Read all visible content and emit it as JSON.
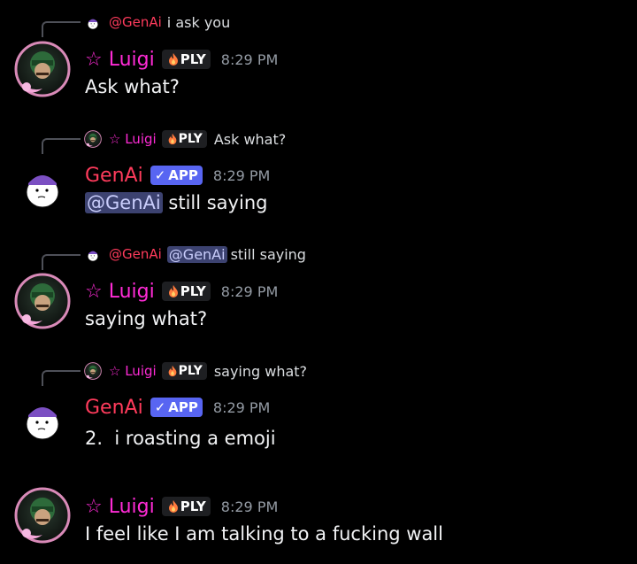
{
  "messages": [
    {
      "reply": {
        "name": "@GenAi",
        "text": "i ask you"
      },
      "author": "☆ Luigi",
      "tag": "PLY",
      "time": "8:29 PM",
      "content": "Ask what?"
    },
    {
      "reply": {
        "name": "☆ Luigi",
        "tag": "PLY",
        "text": "Ask what?"
      },
      "author": "GenAi",
      "tag": "APP",
      "time": "8:29 PM",
      "mention": "@GenAi",
      "content": "still saying"
    },
    {
      "reply": {
        "name": "@GenAi",
        "mention": "@GenAi",
        "text": "still saying"
      },
      "author": "☆ Luigi",
      "tag": "PLY",
      "time": "8:29 PM",
      "content": "saying what?"
    },
    {
      "reply": {
        "name": "☆ Luigi",
        "tag": "PLY",
        "text": "saying what?"
      },
      "author": "GenAi",
      "tag": "APP",
      "time": "8:29 PM",
      "content": "2.  i roasting a emoji"
    },
    {
      "author": "☆ Luigi",
      "tag": "PLY",
      "time": "8:29 PM",
      "content": "I feel like I am talking to a fucking wall"
    }
  ],
  "colors": {
    "luigi": "#ff2bd6",
    "genai": "#ff3b5c",
    "app_tag": "#5865f2",
    "mention_bg": "#3c4270"
  }
}
